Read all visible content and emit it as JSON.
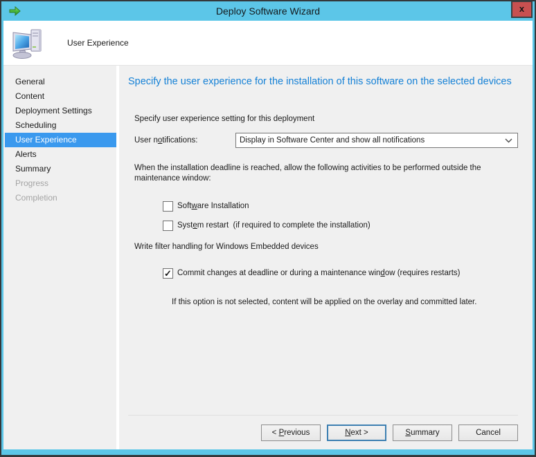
{
  "window": {
    "title": "Deploy Software Wizard",
    "close_glyph": "x"
  },
  "colors": {
    "titlebar": "#5CC6E8",
    "close_button": "#C75050",
    "sidebar_selected": "#3A99EE",
    "heading_text": "#1581D6",
    "default_button_border": "#3C7FB1"
  },
  "header": {
    "title": "User Experience"
  },
  "sidebar": {
    "items": [
      {
        "label": "General",
        "state": "normal"
      },
      {
        "label": "Content",
        "state": "normal"
      },
      {
        "label": "Deployment Settings",
        "state": "normal"
      },
      {
        "label": "Scheduling",
        "state": "normal"
      },
      {
        "label": "User Experience",
        "state": "selected"
      },
      {
        "label": "Alerts",
        "state": "normal"
      },
      {
        "label": "Summary",
        "state": "normal"
      },
      {
        "label": "Progress",
        "state": "disabled"
      },
      {
        "label": "Completion",
        "state": "disabled"
      }
    ]
  },
  "content": {
    "heading": "Specify the user experience for the installation of this software on the selected devices",
    "section_label": "Specify user experience setting for this deployment",
    "notifications": {
      "label_pre": "User n",
      "label_key": "o",
      "label_post": "tifications:",
      "value": "Display in Software Center and show all notifications"
    },
    "deadline_paragraph": "When the installation deadline is reached, allow the following activities to be performed outside the maintenance window:",
    "software_install_checkbox": {
      "checked": false,
      "label_pre": "Soft",
      "label_key": "w",
      "label_post": "are Installation"
    },
    "system_restart_checkbox": {
      "checked": false,
      "label_pre": "Syst",
      "label_key": "e",
      "label_post": "m restart  (if required to complete the installation)"
    },
    "write_filter_label": "Write filter handling for Windows Embedded devices",
    "commit_checkbox": {
      "checked": true,
      "glyph": "✓",
      "label_pre": "Commit changes at deadline or during a maintenance win",
      "label_key": "d",
      "label_post": "ow (requires restarts)"
    },
    "commit_note": "If this option is not selected, content will be applied on the overlay and committed later."
  },
  "footer": {
    "buttons": [
      {
        "name": "previous",
        "pre": "< ",
        "key": "P",
        "post": "revious"
      },
      {
        "name": "next",
        "pre": "",
        "key": "N",
        "post": "ext >",
        "default": true
      },
      {
        "name": "summary",
        "pre": "",
        "key": "S",
        "post": "ummary"
      },
      {
        "name": "cancel",
        "pre": "Cancel",
        "key": "",
        "post": ""
      }
    ]
  }
}
